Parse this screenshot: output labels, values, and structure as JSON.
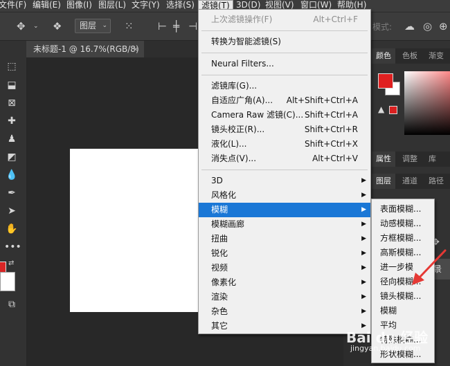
{
  "menubar": {
    "items": [
      "文件(F)",
      "编辑(E)",
      "图像(I)",
      "图层(L)",
      "文字(Y)",
      "选择(S)",
      "滤镜(T)",
      "3D(D)",
      "视图(V)",
      "窗口(W)",
      "帮助(H)"
    ],
    "active_index": 6
  },
  "options_bar": {
    "layer_select": "图层",
    "mode_label": "模式:"
  },
  "document": {
    "tab_title": "未标题-1 @ 16.7%(RGB/8)",
    "close_glyph": "×"
  },
  "filter_menu": {
    "items": [
      {
        "label": "上次滤镜操作(F)",
        "shortcut": "Alt+Ctrl+F",
        "disabled": true
      },
      {
        "label": "转换为智能滤镜(S)"
      },
      {
        "label": "Neural Filters..."
      },
      {
        "label": "滤镜库(G)..."
      },
      {
        "label": "自适应广角(A)...",
        "shortcut": "Alt+Shift+Ctrl+A"
      },
      {
        "label": "Camera Raw 滤镜(C)...",
        "shortcut": "Shift+Ctrl+A"
      },
      {
        "label": "镜头校正(R)...",
        "shortcut": "Shift+Ctrl+R"
      },
      {
        "label": "液化(L)...",
        "shortcut": "Shift+Ctrl+X"
      },
      {
        "label": "消失点(V)...",
        "shortcut": "Alt+Ctrl+V"
      },
      {
        "label": "3D",
        "submenu": true
      },
      {
        "label": "风格化",
        "submenu": true
      },
      {
        "label": "模糊",
        "submenu": true,
        "highlighted": true
      },
      {
        "label": "模糊画廊",
        "submenu": true
      },
      {
        "label": "扭曲",
        "submenu": true
      },
      {
        "label": "锐化",
        "submenu": true
      },
      {
        "label": "视频",
        "submenu": true
      },
      {
        "label": "像素化",
        "submenu": true
      },
      {
        "label": "渲染",
        "submenu": true
      },
      {
        "label": "杂色",
        "submenu": true
      },
      {
        "label": "其它",
        "submenu": true
      }
    ],
    "arrow_glyph": "▶"
  },
  "blur_submenu": {
    "items": [
      "表面模糊...",
      "动感模糊...",
      "方框模糊...",
      "高斯模糊...",
      "进一步模",
      "径向模糊...",
      "镜头模糊...",
      "模糊",
      "平均",
      "特殊模糊...",
      "形状模糊..."
    ]
  },
  "right_panels": {
    "color_tabs": [
      "颜色",
      "色板",
      "渐变"
    ],
    "props_tabs": [
      "属性",
      "调整",
      "库"
    ],
    "layer_tabs": [
      "图层",
      "通道",
      "路径"
    ],
    "layer_row_text": "景"
  },
  "watermark": {
    "main": "Bai du 经验",
    "sub": "jingyan.baidu.com"
  },
  "colors": {
    "highlight": "#1a77d6",
    "foreground": "#d92626",
    "arrow": "#e53935"
  }
}
